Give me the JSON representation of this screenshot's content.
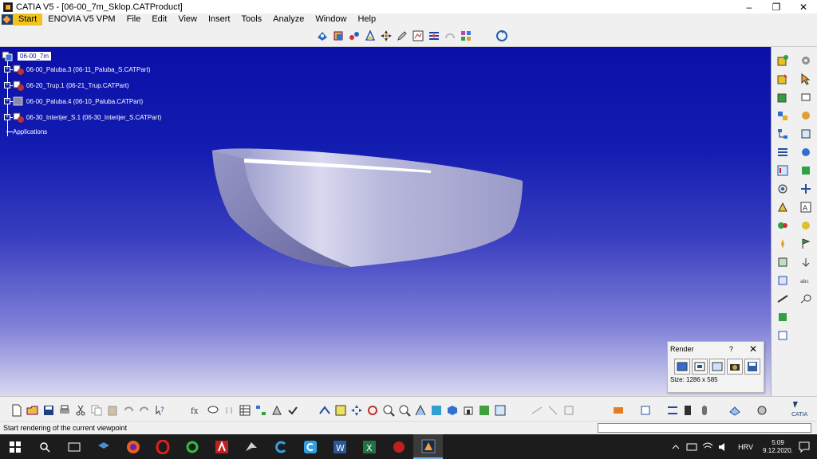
{
  "window": {
    "title": "CATIA V5 - [06-00_7m_Sklop.CATProduct]",
    "minimize": "–",
    "restore": "❐",
    "close": "✕"
  },
  "menu": {
    "items": [
      "Start",
      "ENOVIA V5 VPM",
      "File",
      "Edit",
      "View",
      "Insert",
      "Tools",
      "Analyze",
      "Window",
      "Help"
    ]
  },
  "tree": {
    "root": "06-00_7m",
    "children": [
      "06-00_Paluba.3 (06-11_Paluba_S.CATPart)",
      "06-20_Trup.1 (06-21_Trup.CATPart)",
      "06-00_Paluba.4 (06-10_Paluba.CATPart)",
      "06-30_Interijer_S.1 (06-30_Interijer_S.CATPart)"
    ],
    "applications": "Applications"
  },
  "render_panel": {
    "title": "Render",
    "help": "?",
    "close": "✕",
    "size": "Size: 1286 x 585"
  },
  "status": {
    "message": "Start rendering of the current viewpoint"
  },
  "taskbar": {
    "lang": "HRV",
    "time": "5:09",
    "date": "9.12.2020."
  },
  "colors": {
    "viewport_top": "#0a0fa8",
    "viewport_bottom": "#d8d8f0",
    "menu_highlight": "#f2c21f",
    "taskbar_bg": "#1c1c1c"
  }
}
